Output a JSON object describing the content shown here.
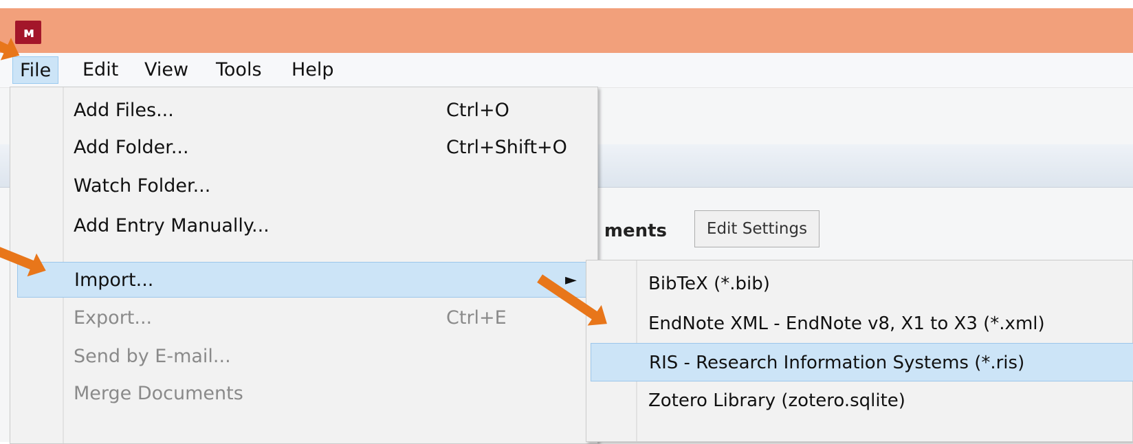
{
  "app": {
    "icon": "mendeley-logo-icon",
    "titlebar_color": "#f2a07b",
    "menus": [
      {
        "label": "File"
      },
      {
        "label": "Edit"
      },
      {
        "label": "View"
      },
      {
        "label": "Tools"
      },
      {
        "label": "Help"
      }
    ]
  },
  "background": {
    "panel_label": "ments",
    "edit_settings": "Edit Settings"
  },
  "file_menu": {
    "items": [
      {
        "label": "Add Files...",
        "shortcut": "Ctrl+O"
      },
      {
        "label": "Add Folder...",
        "shortcut": "Ctrl+Shift+O"
      },
      {
        "label": "Watch Folder...",
        "shortcut": ""
      },
      {
        "label": "Add Entry Manually...",
        "shortcut": ""
      },
      {
        "label": "Import...",
        "shortcut": ""
      },
      {
        "label": "Export...",
        "shortcut": "Ctrl+E"
      },
      {
        "label": "Send by E-mail...",
        "shortcut": ""
      },
      {
        "label": "Merge Documents",
        "shortcut": ""
      }
    ]
  },
  "import_submenu": {
    "items": [
      {
        "label": "BibTeX (*.bib)"
      },
      {
        "label": "EndNote XML - EndNote v8, X1 to X3 (*.xml)"
      },
      {
        "label": "RIS - Research Information Systems (*.ris)"
      },
      {
        "label": "Zotero Library (zotero.sqlite)"
      }
    ]
  },
  "annotation_color": "#e8761a",
  "highlight_color": "#cce4f7"
}
